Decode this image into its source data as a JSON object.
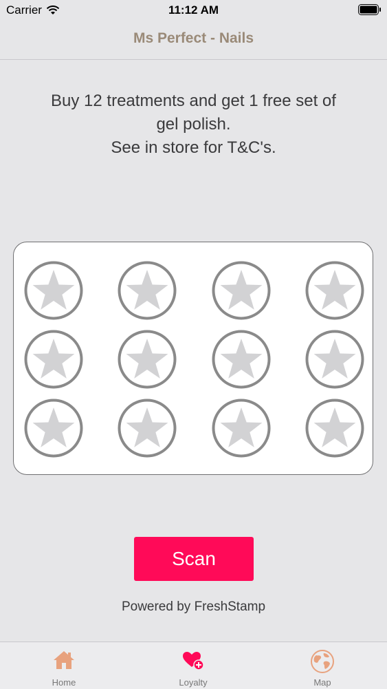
{
  "status_bar": {
    "carrier": "Carrier",
    "time": "11:12 AM"
  },
  "nav": {
    "title": "Ms Perfect - Nails"
  },
  "promo": {
    "line1": "Buy 12 treatments and get 1 free set of",
    "line2": "gel polish.",
    "line3": "See in store for T&C's."
  },
  "stamp_card": {
    "total_stamps": 12,
    "collected": 0,
    "stamp_icon": "star-icon",
    "stamp_color": "#d2d2d4",
    "ring_color": "#8a8a8a"
  },
  "scan_button": {
    "label": "Scan",
    "color": "#ff0a58"
  },
  "footer": {
    "powered_by": "Powered by FreshStamp"
  },
  "tabs": [
    {
      "label": "Home",
      "icon": "home-icon",
      "color": "#e8a27e",
      "selected": false
    },
    {
      "label": "Loyalty",
      "icon": "heart-plus-icon",
      "color": "#ff0a58",
      "selected": true
    },
    {
      "label": "Map",
      "icon": "globe-icon",
      "color": "#e8a27e",
      "selected": false
    }
  ]
}
